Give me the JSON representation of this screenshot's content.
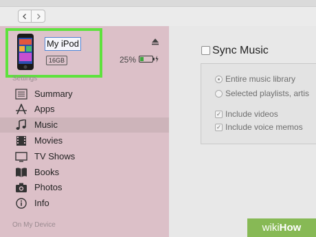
{
  "device": {
    "name": "My iPod",
    "capacity": "16GB",
    "battery": "25%"
  },
  "sidebar": {
    "settings_title": "Settings",
    "items": [
      {
        "label": "Summary",
        "icon": "summary-list-icon"
      },
      {
        "label": "Apps",
        "icon": "apps-a-icon"
      },
      {
        "label": "Music",
        "icon": "music-note-icon"
      },
      {
        "label": "Movies",
        "icon": "film-icon"
      },
      {
        "label": "TV Shows",
        "icon": "tv-icon"
      },
      {
        "label": "Books",
        "icon": "book-icon"
      },
      {
        "label": "Photos",
        "icon": "camera-icon"
      },
      {
        "label": "Info",
        "icon": "info-icon"
      }
    ],
    "selected": "Music",
    "on_device_title": "On My Device"
  },
  "main": {
    "sync_label": "Sync Music",
    "options": {
      "entire_library": "Entire music library",
      "selected_playlists": "Selected playlists, artis",
      "include_videos": "Include videos",
      "include_voice_memos": "Include voice memos"
    }
  },
  "watermark": {
    "part1": "wiki",
    "part2": "How"
  },
  "colors": {
    "sidebar_bg": "#dcc0c8",
    "highlight_border": "#5ee23d",
    "watermark_bg": "#87b955"
  }
}
